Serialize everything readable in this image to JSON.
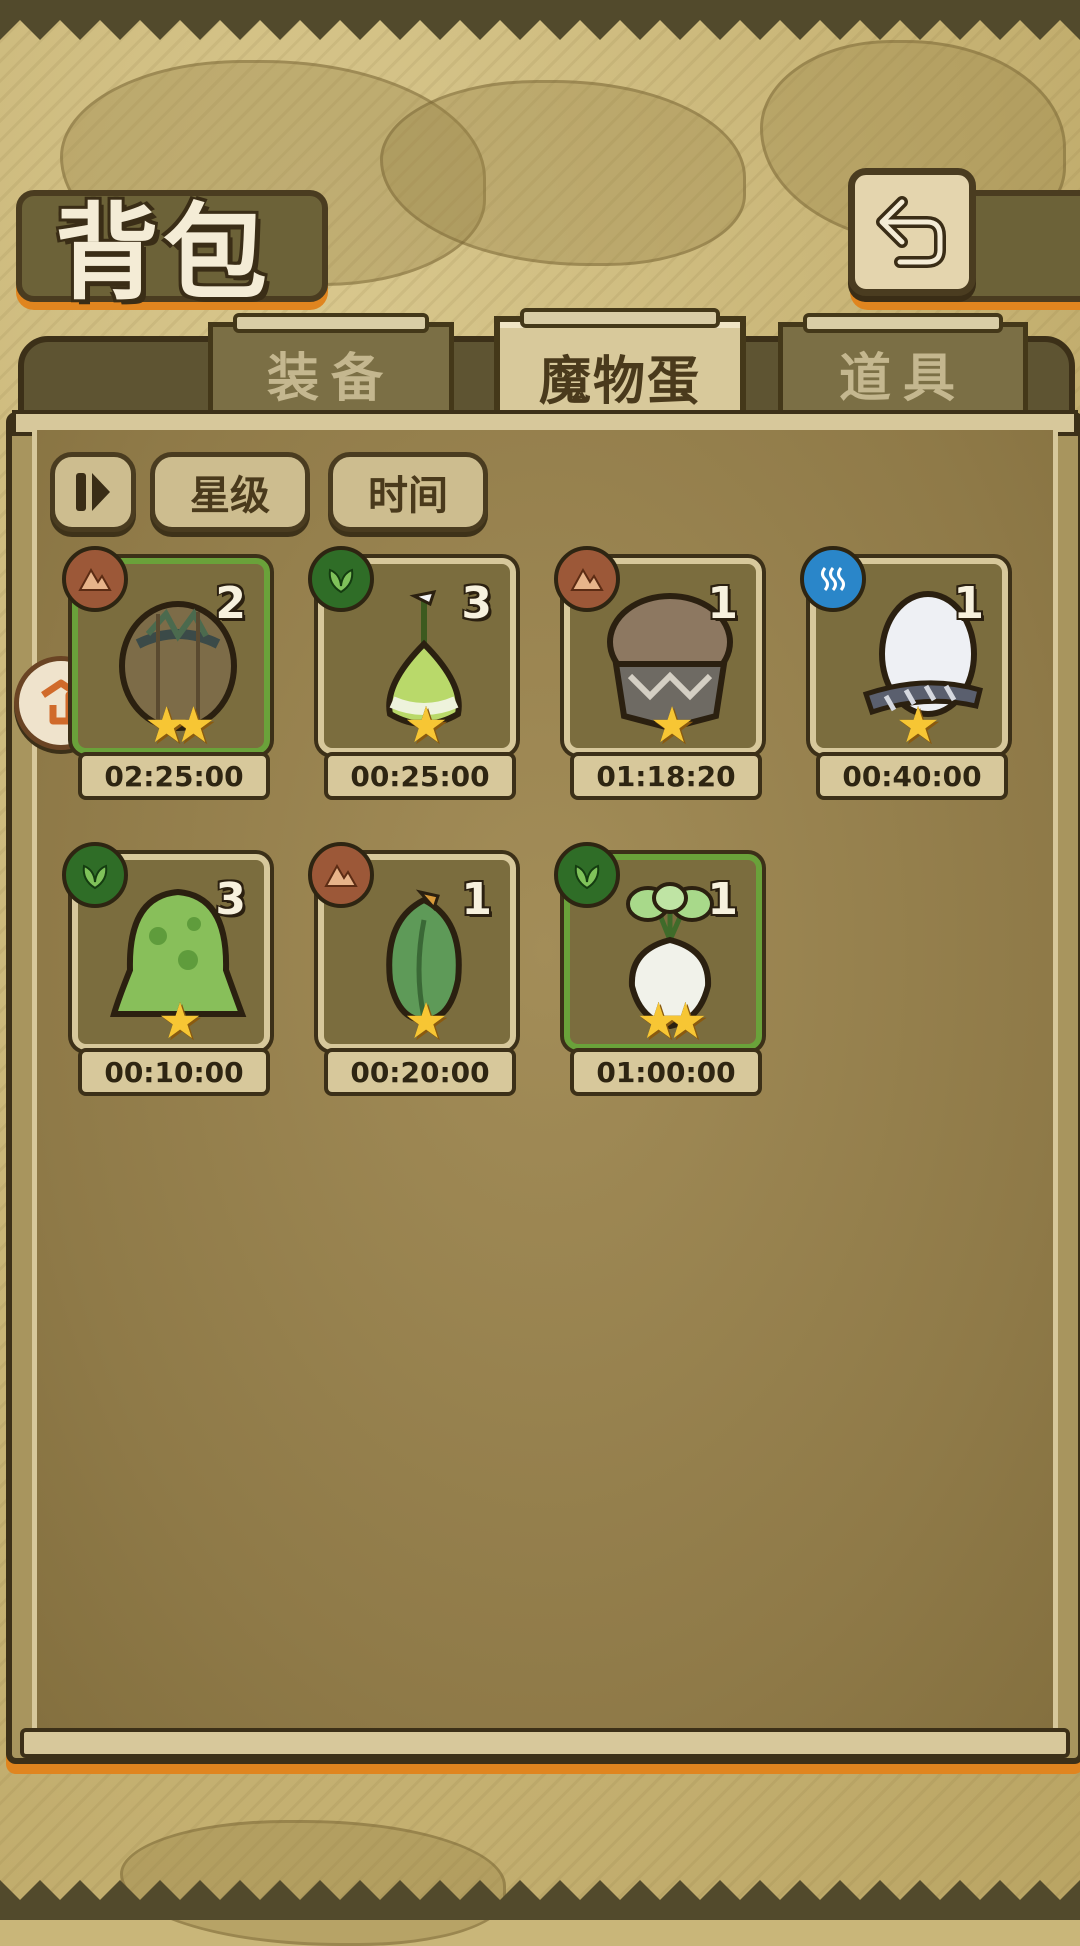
{
  "title": "背包",
  "tabs": [
    {
      "label": "装备",
      "active": false
    },
    {
      "label": "魔物蛋",
      "active": true
    },
    {
      "label": "道具",
      "active": false
    }
  ],
  "sort": {
    "toggle_icon": "sort-order-icon",
    "star_label": "星级",
    "time_label": "时间"
  },
  "items": [
    {
      "element": "earth",
      "count": "2",
      "stars": 2,
      "timer": "02:25:00",
      "highlight": true,
      "icon": "rock-egg-icon"
    },
    {
      "element": "plant",
      "count": "3",
      "stars": 1,
      "timer": "00:25:00",
      "highlight": false,
      "icon": "sprout-egg-icon"
    },
    {
      "element": "earth",
      "count": "1",
      "stars": 1,
      "timer": "01:18:20",
      "highlight": false,
      "icon": "mushroom-egg-icon"
    },
    {
      "element": "water",
      "count": "1",
      "stars": 1,
      "timer": "00:40:00",
      "highlight": false,
      "icon": "white-egg-icon"
    },
    {
      "element": "plant",
      "count": "3",
      "stars": 1,
      "timer": "00:10:00",
      "highlight": false,
      "icon": "slime-egg-icon"
    },
    {
      "element": "earth",
      "count": "1",
      "stars": 1,
      "timer": "00:20:00",
      "highlight": false,
      "icon": "leaf-bud-egg-icon"
    },
    {
      "element": "plant",
      "count": "1",
      "stars": 2,
      "timer": "01:00:00",
      "highlight": true,
      "icon": "turnip-egg-icon"
    }
  ],
  "colors": {
    "accent_orange": "#e0851f",
    "panel_border": "#3c3018",
    "earth": "#9c5838",
    "plant": "#2f6d27",
    "water": "#2a86c9",
    "star": "#f7c634"
  }
}
